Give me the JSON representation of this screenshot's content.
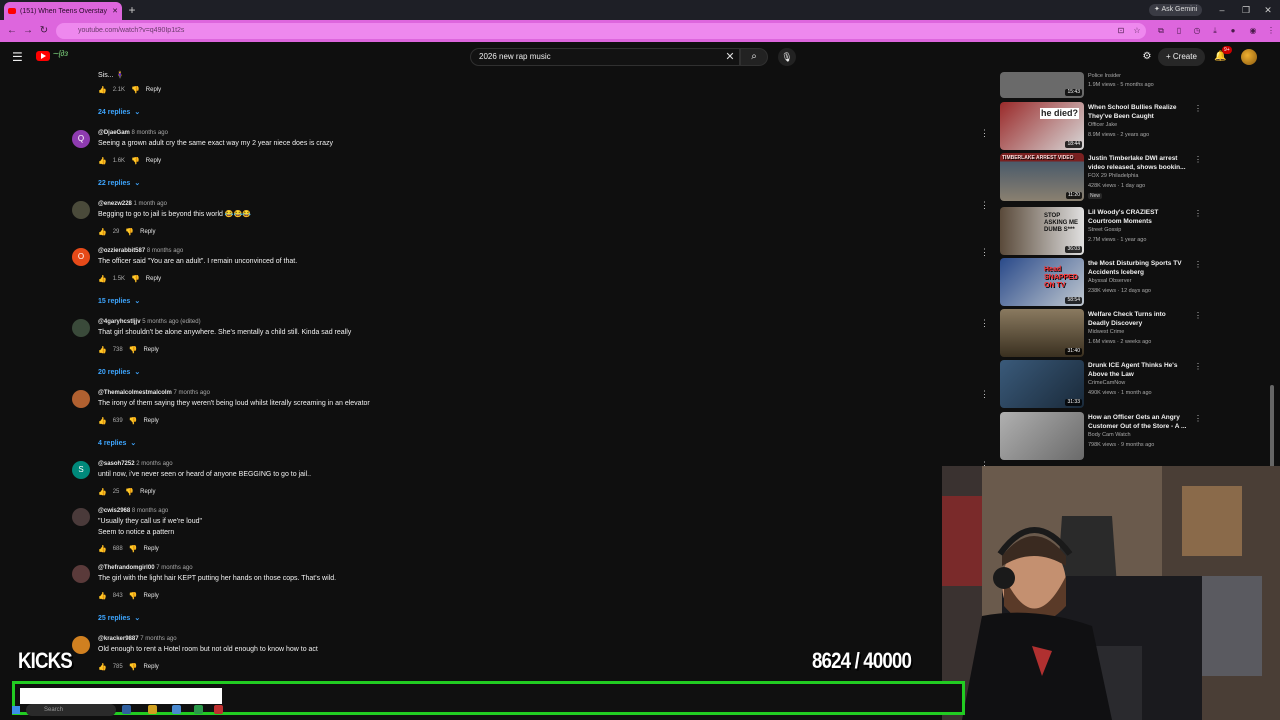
{
  "browser": {
    "tab_title": "(151) When Teens Overstay The...",
    "new_tab_icon": "plus-icon",
    "ask_gemini": "Ask Gemini",
    "url": "youtube.com/watch?v=q490Ip1t2s",
    "window_controls": [
      "minimize-icon",
      "restore-icon",
      "close-icon"
    ]
  },
  "youtube": {
    "search_value": "2026 new rap music",
    "create_label": "Create",
    "notification_count": "9+"
  },
  "comments": [
    {
      "author": "",
      "time": "",
      "text": "Sis... 🧍‍♀️",
      "likes": "2.1K",
      "replies": "24 replies",
      "avatar_letter": "",
      "avatar_color": "#0f0f0f"
    },
    {
      "author": "@DjaeGam",
      "time": "8 months ago",
      "text": "Seeing a grown adult cry the same exact way my 2 year niece does is crazy",
      "likes": "1.6K",
      "replies": "22 replies",
      "avatar_letter": "Q",
      "avatar_color": "#8e3bb0"
    },
    {
      "author": "@enezw228",
      "time": "1 month ago",
      "text": "Begging to go to jail is beyond this world 😂😂😂",
      "likes": "29",
      "replies": "",
      "avatar_letter": "",
      "avatar_color": "#4a4a3a"
    },
    {
      "author": "@ozzierabbit587",
      "time": "8 months ago",
      "text": "The officer said \"You are an adult\". I remain unconvinced of that.",
      "likes": "1.5K",
      "replies": "15 replies",
      "avatar_letter": "O",
      "avatar_color": "#e64a19"
    },
    {
      "author": "@4garyhcstljjv",
      "time": "5 months ago (edited)",
      "text": "That girl shouldn't  be alone anywhere. She's mentally a child still. Kinda sad really",
      "likes": "738",
      "replies": "20 replies",
      "avatar_letter": "",
      "avatar_color": "#3a4a3a"
    },
    {
      "author": "@Themalcolmestmalcolm",
      "time": "7 months ago",
      "text": "The irony of them saying they weren't being loud whilst literally screaming in an elevator",
      "likes": "639",
      "replies": "4 replies",
      "avatar_letter": "",
      "avatar_color": "#b06030"
    },
    {
      "author": "@sasoh7252",
      "time": "2 months ago",
      "text": "until now, i've never seen or heard of anyone BEGGING to go to jail..",
      "likes": "25",
      "replies": "",
      "avatar_letter": "S",
      "avatar_color": "#00897b"
    },
    {
      "author": "@cwis2968",
      "time": "8 months ago",
      "text": "\"Usually they call us if we're loud\"",
      "text2": "Seem to notice a pattern",
      "likes": "688",
      "replies": "",
      "avatar_letter": "",
      "avatar_color": "#4a3a3a"
    },
    {
      "author": "@Thefrandomgirl00",
      "time": "7 months ago",
      "text": "The girl with the light hair KEPT putting her hands on those cops. That's wild.",
      "likes": "843",
      "replies": "25 replies",
      "avatar_letter": "",
      "avatar_color": "#5a3a3a"
    },
    {
      "author": "@kracker9887",
      "time": "7 months ago",
      "text": "Old enough to rent a Hotel room but not old enough to know how to act",
      "likes": "785",
      "replies": "",
      "avatar_letter": "",
      "avatar_color": "#d08020"
    }
  ],
  "reply_label": "Reply",
  "sidebar": [
    {
      "title": "",
      "channel": "Police Insider",
      "views": "1.9M views · 5 months ago",
      "duration": "15:43",
      "thumb_text": "",
      "thumb_color": "#6a6a6a",
      "new": ""
    },
    {
      "title": "When School Bullies Realize They've Been Caught",
      "channel": "Officer Jake",
      "views": "8.9M views · 2 years ago",
      "duration": "18:44",
      "thumb_text": "he died?",
      "thumb_color": "#9a2a2a",
      "new": ""
    },
    {
      "title": "Justin Timberlake DWI arrest video released, shows bookin...",
      "channel": "FOX 29 Philadelphia",
      "views": "428K views · 1 day ago",
      "duration": "11:20",
      "thumb_text": "TIMBERLAKE ARREST VIDEO",
      "thumb_color": "#7a2020",
      "new": "New"
    },
    {
      "title": "Lil Woody's CRAZIEST Courtroom Moments",
      "channel": "Street Gossip",
      "views": "2.7M views · 1 year ago",
      "duration": "36:03",
      "thumb_text": "STOP ASKING ME DUMB S***",
      "thumb_color": "#5a4a3a",
      "new": ""
    },
    {
      "title": "the Most Disturbing Sports TV Accidents Iceberg",
      "channel": "Abyssal Observer",
      "views": "238K views · 12 days ago",
      "duration": "58:54",
      "thumb_text": "Head SNAPPED ON TV",
      "thumb_color": "#2a4a8a",
      "new": ""
    },
    {
      "title": "Welfare Check Turns into Deadly Discovery",
      "channel": "Midwest Crime",
      "views": "1.6M views · 2 weeks ago",
      "duration": "31:40",
      "thumb_text": "",
      "thumb_color": "#5a5040",
      "new": ""
    },
    {
      "title": "Drunk ICE Agent Thinks He's Above the Law",
      "channel": "CrimeCamNow",
      "views": "490K views · 1 month ago",
      "duration": "31:33",
      "thumb_text": "",
      "thumb_color": "#3a5a7a",
      "new": ""
    },
    {
      "title": "How an Officer Gets an Angry Customer Out of the Store - A ...",
      "channel": "Body Cam Watch",
      "views": "798K views · 9 months ago",
      "duration": "",
      "thumb_text": "",
      "thumb_color": "#8a8a8a",
      "new": ""
    }
  ],
  "overlay": {
    "label": "KICKS",
    "current": "8624",
    "separator": "/",
    "goal": "40000",
    "progress_fraction": 0.2156,
    "accent": "#22cc22"
  },
  "taskbar": {
    "search_placeholder": "Search"
  }
}
